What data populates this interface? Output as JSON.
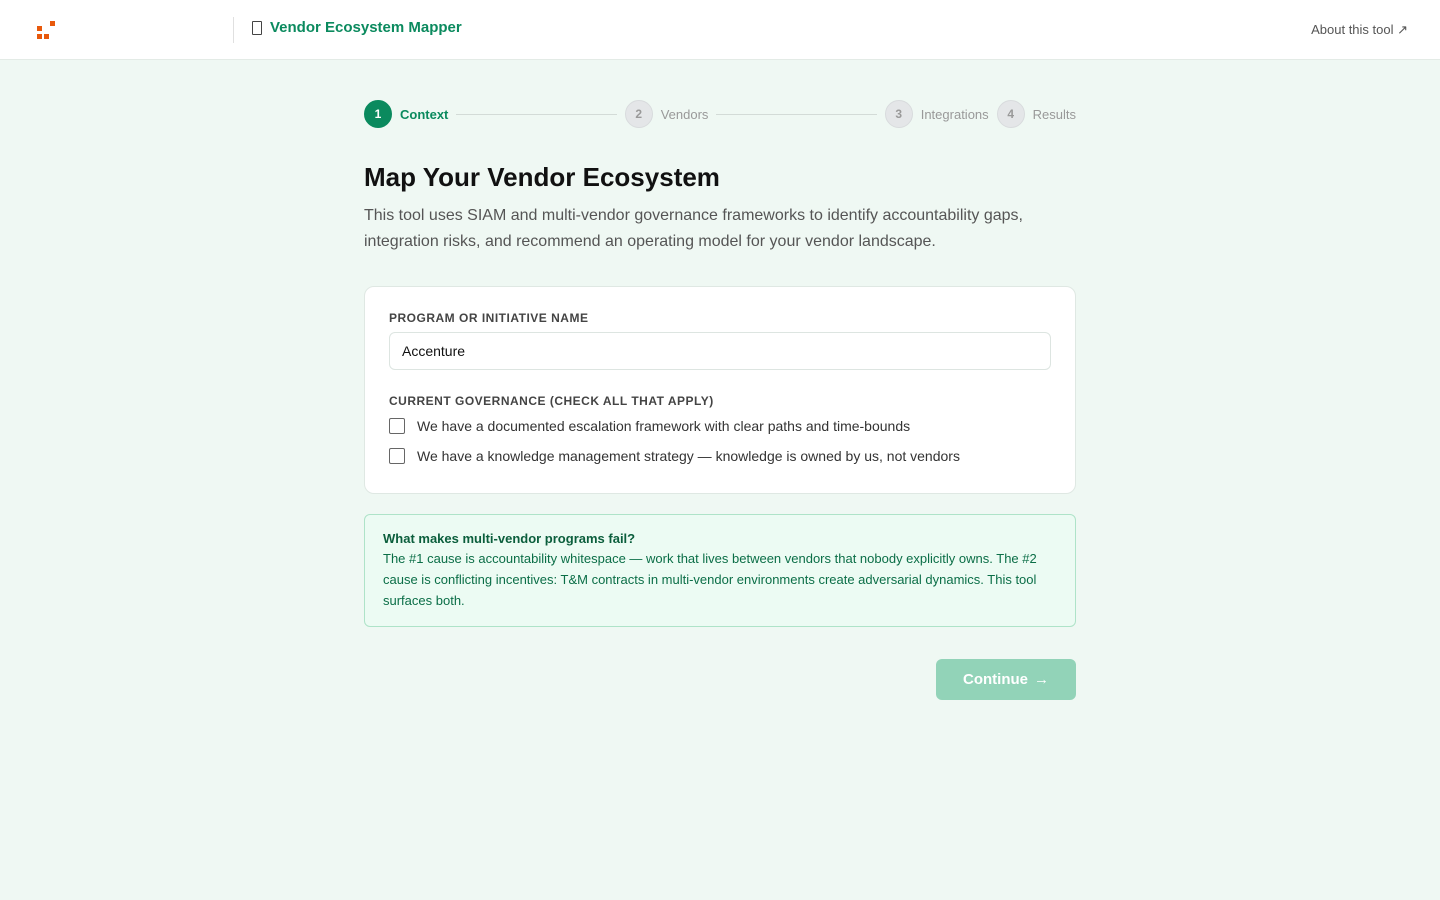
{
  "header": {
    "app_title": "Vendor Ecosystem Mapper",
    "about_link": "About this tool ↗",
    "brand_color": "#0b8a5e",
    "logo_color": "#e8590c"
  },
  "stepper": {
    "steps": [
      {
        "number": "1",
        "label": "Context",
        "active": true
      },
      {
        "number": "2",
        "label": "Vendors",
        "active": false
      },
      {
        "number": "3",
        "label": "Integrations",
        "active": false
      },
      {
        "number": "4",
        "label": "Results",
        "active": false
      }
    ]
  },
  "main": {
    "title": "Map Your Vendor Ecosystem",
    "description": "This tool uses SIAM and multi-vendor governance frameworks to identify accountability gaps, integration risks, and recommend an operating model for your vendor landscape."
  },
  "form": {
    "program_label": "PROGRAM OR INITIATIVE NAME",
    "program_value": "Accenture",
    "governance_label": "CURRENT GOVERNANCE (CHECK ALL THAT APPLY)",
    "checkboxes": [
      {
        "label": "We have a documented escalation framework with clear paths and time-bounds",
        "checked": false
      },
      {
        "label": "We have a knowledge management strategy — knowledge is owned by us, not vendors",
        "checked": false
      }
    ]
  },
  "info": {
    "title": "What makes multi-vendor programs fail?",
    "body": "The #1 cause is accountability whitespace — work that lives between vendors that nobody explicitly owns. The #2 cause is conflicting incentives: T&M contracts in multi-vendor environments create adversarial dynamics. This tool surfaces both."
  },
  "actions": {
    "continue_label": "Continue",
    "continue_arrow": "→"
  }
}
